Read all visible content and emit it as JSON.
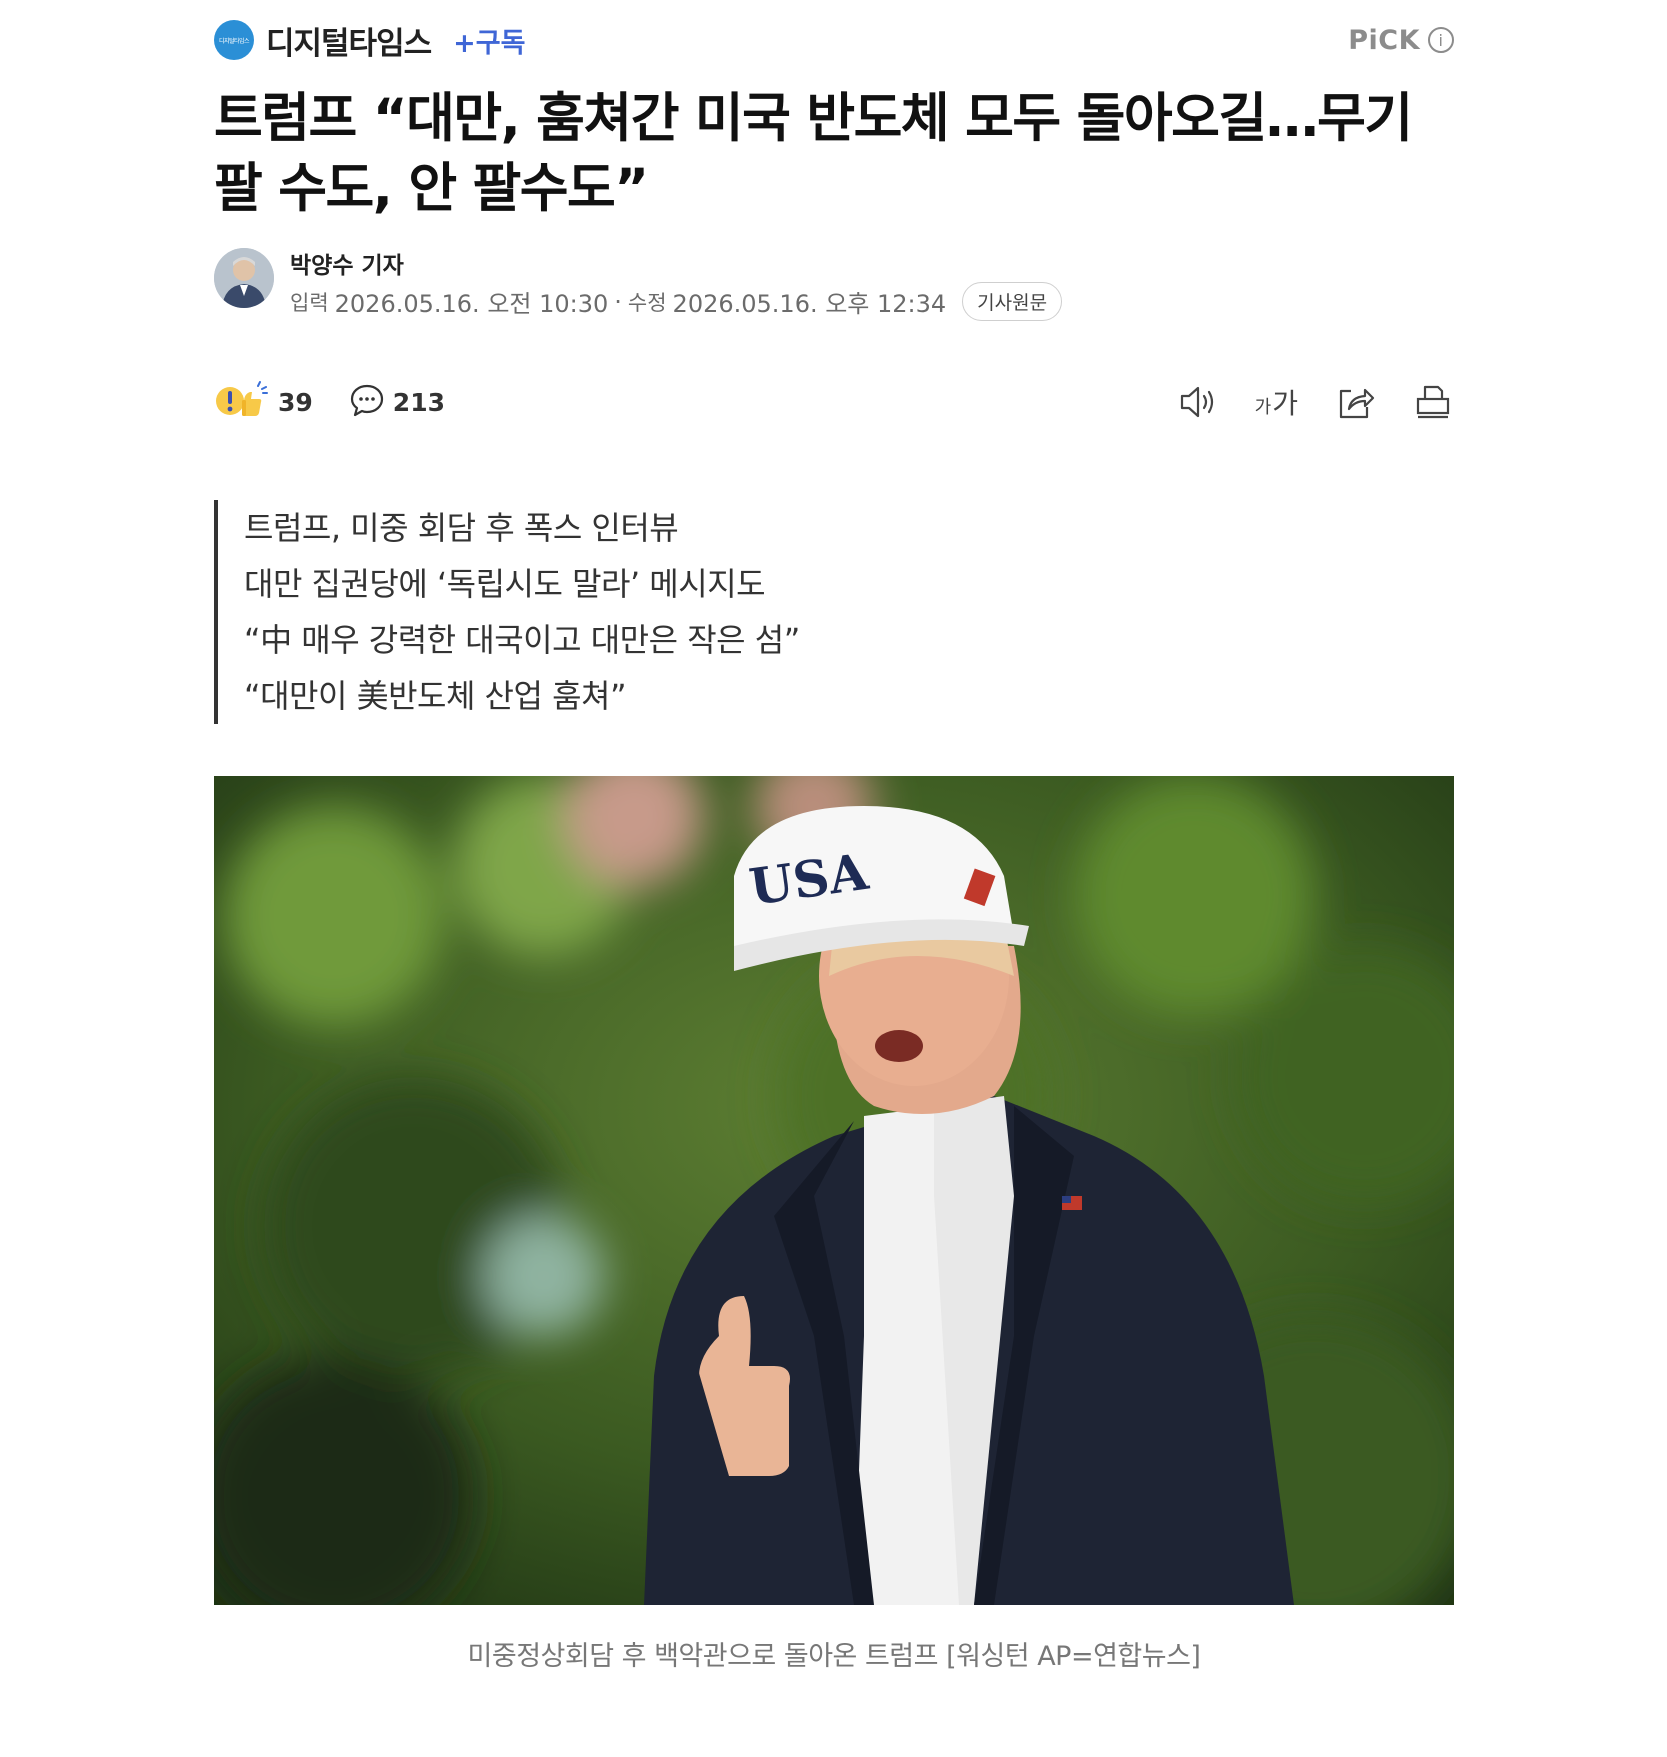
{
  "press": {
    "name": "디지털타임스",
    "logo_text": "디지털타임스",
    "subscribe_label": "+구독"
  },
  "pick": {
    "label": "PiCK",
    "info_symbol": "i"
  },
  "headline": "트럼프 “대만, 훔쳐간 미국 반도체 모두 돌아오길…무기 팔 수도, 안 팔수도”",
  "byline": {
    "reporter": "박양수 기자",
    "input_label": "입력",
    "input_date": "2026.05.16. 오전 10:30",
    "separator": "·",
    "edit_label": "수정",
    "edit_date": "2026.05.16. 오후 12:34",
    "original_button": "기사원문"
  },
  "actions": {
    "reaction_count": "39",
    "comment_count": "213",
    "font_size_small": "가",
    "font_size_large": "가"
  },
  "icons": {
    "reaction": "reaction-emoji-icon",
    "comment": "comment-bubble-icon",
    "audio": "speaker-icon",
    "share": "share-icon",
    "print": "print-icon",
    "info": "info-icon"
  },
  "summary": [
    "트럼프, 미중 회담 후 폭스 인터뷰",
    "대만 집권당에 ‘독립시도 말라’ 메시지도",
    "“中 매우 강력한 대국이고 대만은 작은 섬”",
    "“대만이 美반도체 산업 훔쳐”"
  ],
  "photo": {
    "cap_text": "USA"
  },
  "caption": "미중정상회담 후 백악관으로 돌아온 트럼프 [워싱턴 AP=연합뉴스]",
  "colors": {
    "accent_blue": "#3f66d6",
    "press_logo": "#2b8fd6",
    "muted_text": "#777777"
  }
}
